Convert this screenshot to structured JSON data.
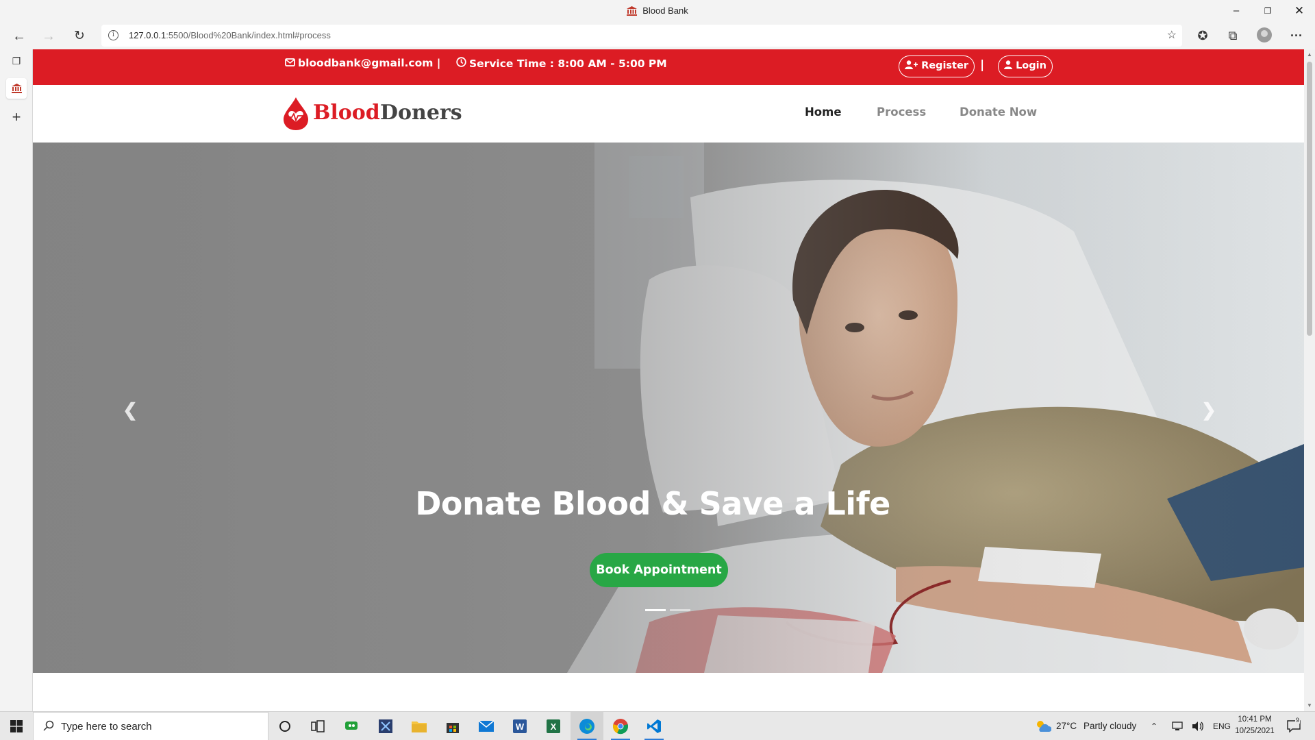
{
  "browser": {
    "window_title": "Blood Bank",
    "url_host": "127.0.0.1",
    "url_rest": ":5500/Blood%20Bank/index.html#process"
  },
  "topbar": {
    "email": "bloodbank@gmail.com |",
    "service_time": "Service Time : 8:00 AM - 5:00 PM",
    "register_label": "Register",
    "separator": "|",
    "login_label": "Login"
  },
  "navbar": {
    "brand_red": "Blood",
    "brand_dark": "Doners",
    "menu": [
      {
        "label": "Home",
        "active": true
      },
      {
        "label": "Process",
        "active": false
      },
      {
        "label": "Donate Now",
        "active": false
      }
    ]
  },
  "hero": {
    "headline": "Donate Blood & Save a Life",
    "cta_label": "Book Appointment",
    "slides": 2,
    "active_slide": 1
  },
  "taskbar": {
    "search_placeholder": "Type here to search",
    "weather_temp": "27°C",
    "weather_text": "Partly cloudy",
    "language": "ENG",
    "time": "10:41 PM",
    "date": "10/25/2021",
    "notification_count": "9"
  },
  "colors": {
    "brand_red": "#dc1c24",
    "cta_green": "#28a745",
    "nav_active": "#222222",
    "nav_inactive": "#888888"
  },
  "icons": [
    "bank-icon",
    "back-icon",
    "forward-icon",
    "refresh-icon",
    "info-icon",
    "favorite-add-icon",
    "favorites-icon",
    "collections-icon",
    "profile-icon",
    "more-icon",
    "envelope-icon",
    "clock-icon",
    "user-plus-icon",
    "user-icon",
    "blood-drop-heart-icon",
    "chevron-left-icon",
    "chevron-right-icon",
    "windows-start-icon",
    "search-icon",
    "cortana-icon",
    "task-view-icon",
    "weather-icon",
    "notification-icon"
  ]
}
